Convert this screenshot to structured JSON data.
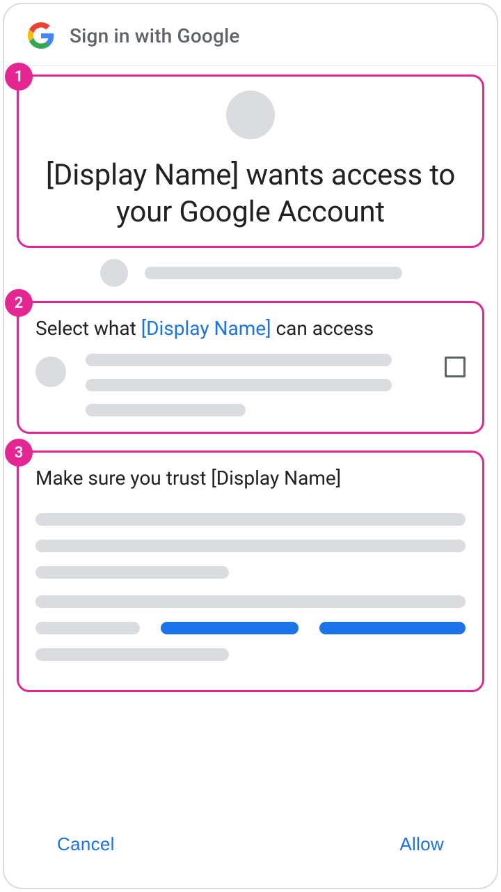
{
  "header": {
    "title": "Sign in with Google"
  },
  "callouts": {
    "one": "1",
    "two": "2",
    "three": "3"
  },
  "section1": {
    "heading": "[Display Name] wants access to your Google Account"
  },
  "section2": {
    "heading_pre": "Select what ",
    "heading_link": "[Display Name]",
    "heading_post": " can access"
  },
  "section3": {
    "heading": "Make sure you trust [Display Name]"
  },
  "footer": {
    "cancel": "Cancel",
    "allow": "Allow"
  },
  "colors": {
    "accent": "#e52592",
    "link": "#1a73e8"
  }
}
